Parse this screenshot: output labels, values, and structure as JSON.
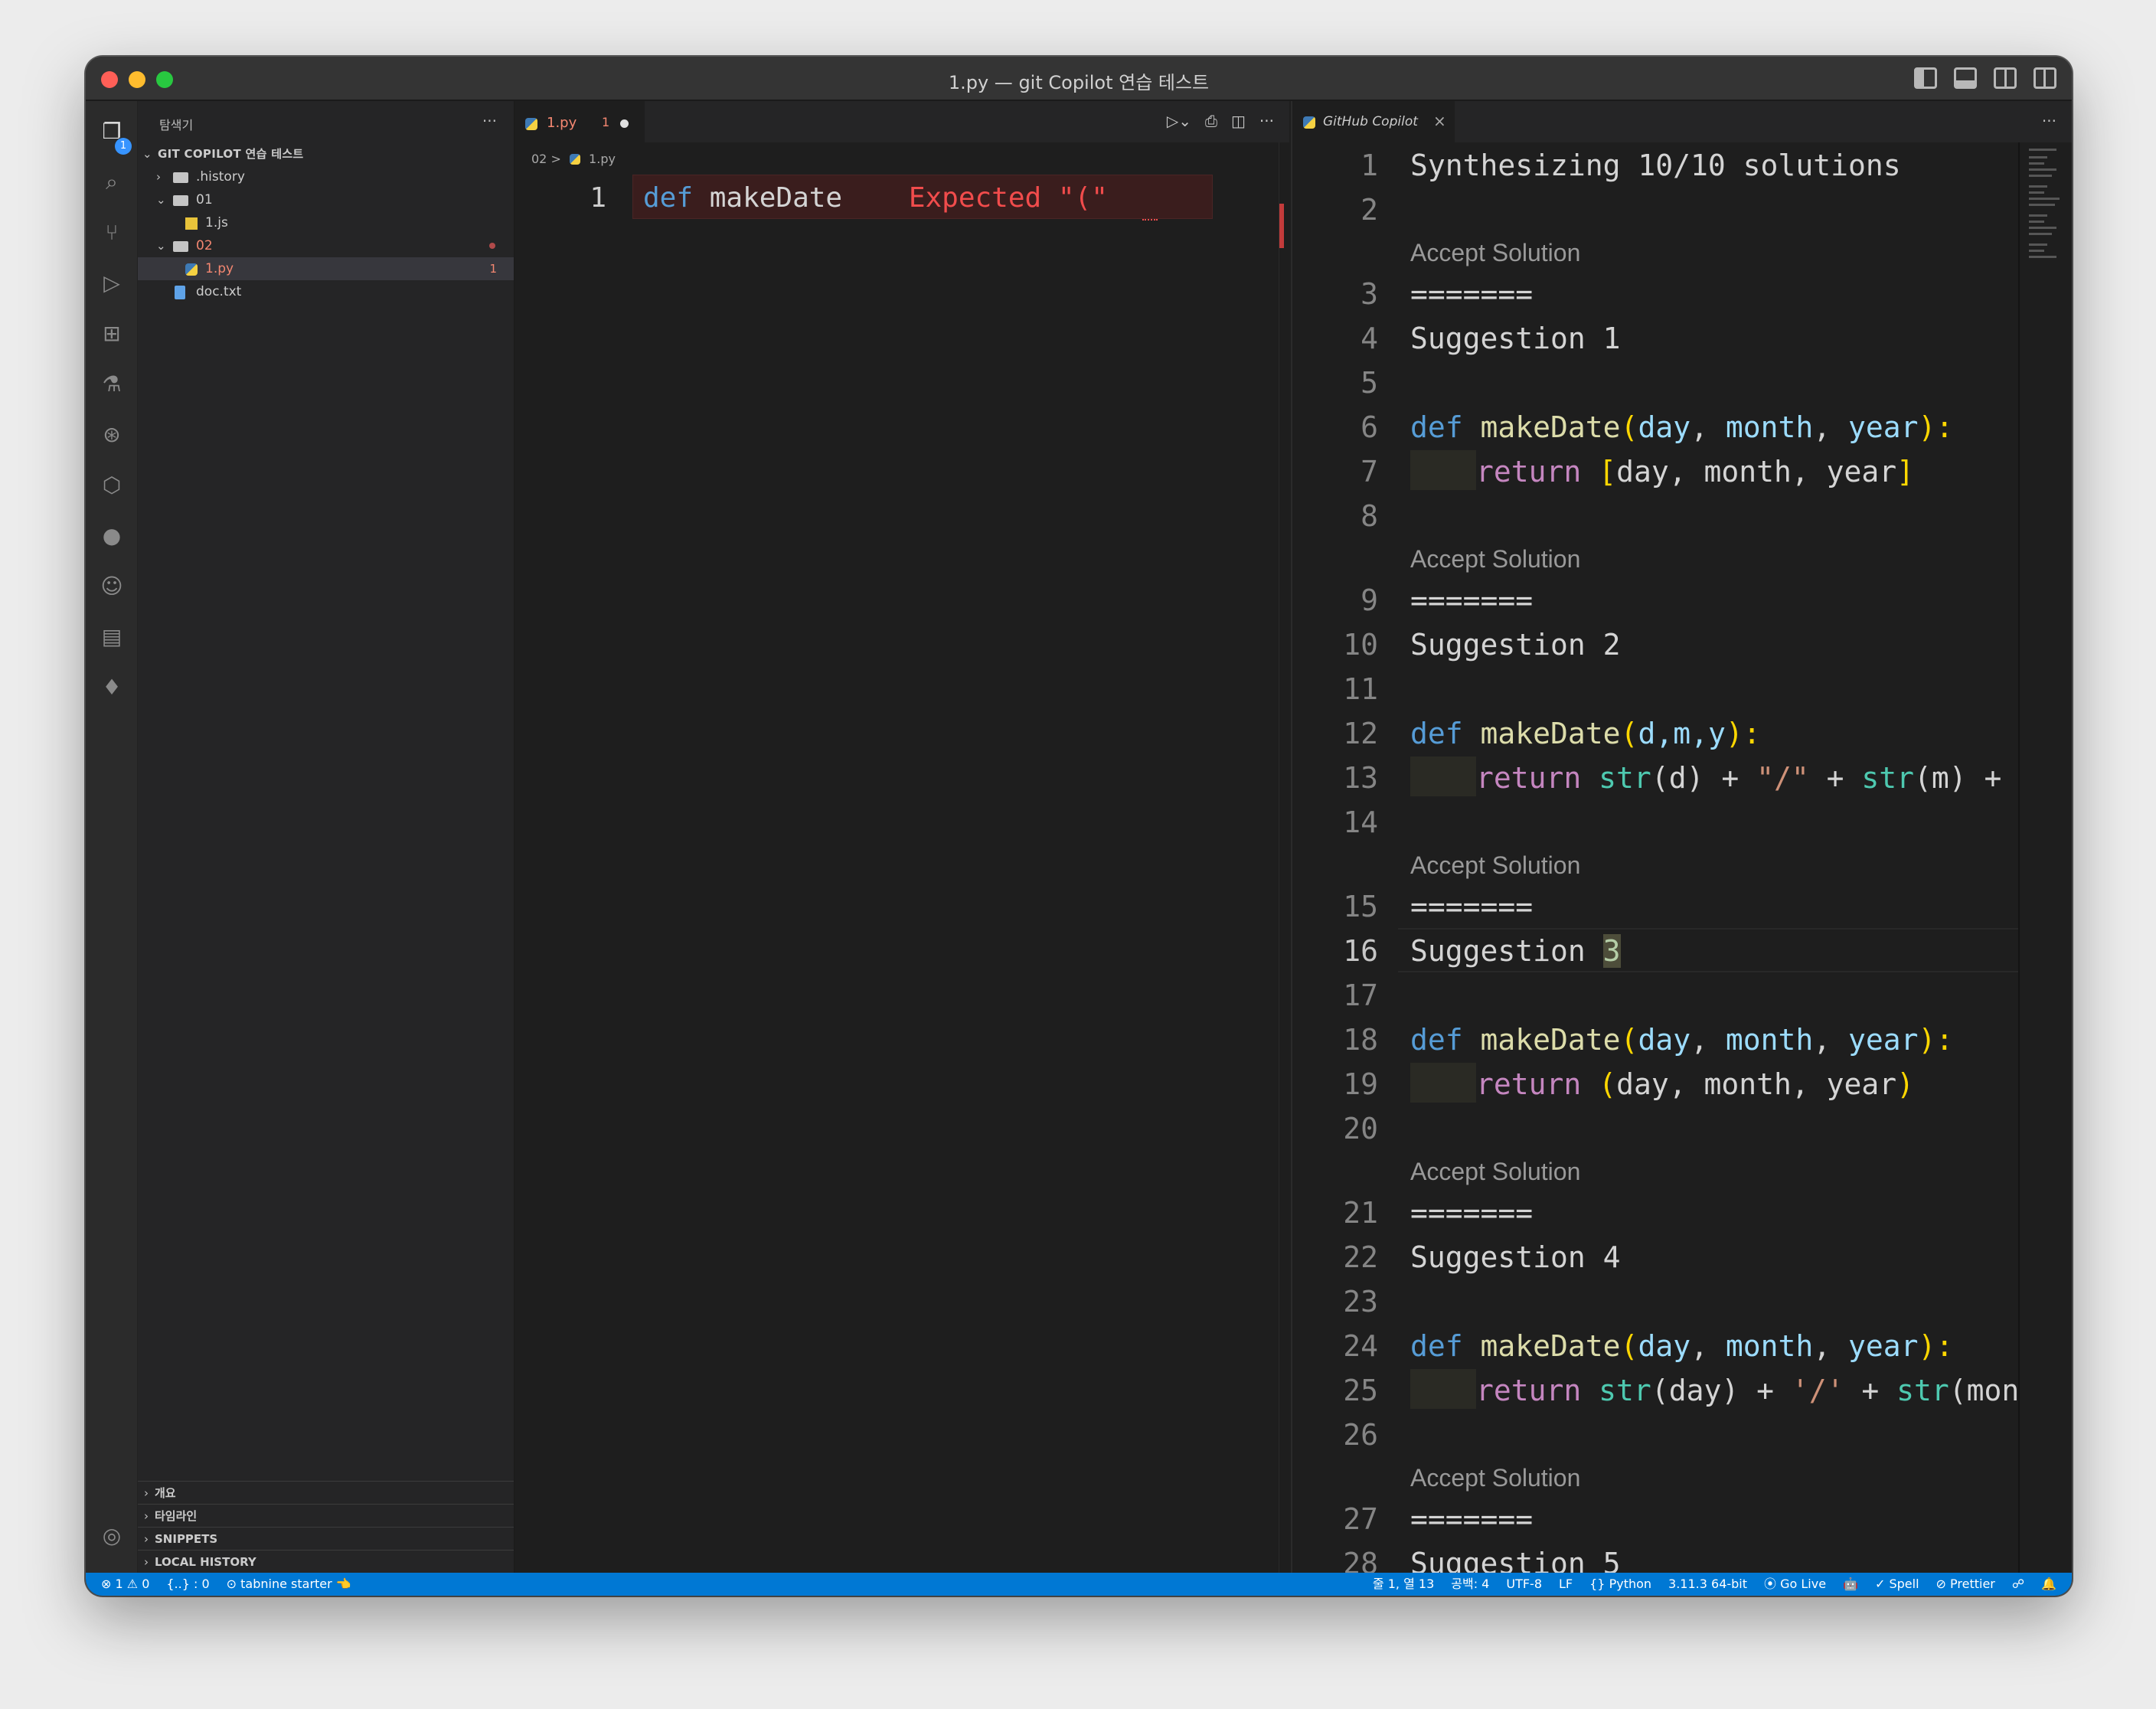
{
  "window": {
    "title": "1.py — git Copilot 연습 테스트"
  },
  "activity_bar": {
    "explorer_badge": "1"
  },
  "sidebar": {
    "header": "탐색기",
    "more": "···",
    "root": "GIT COPILOT 연습 테스트",
    "items": [
      {
        "label": ".history"
      },
      {
        "label": "01"
      },
      {
        "label": "1.js"
      },
      {
        "label": "02"
      },
      {
        "label": "1.py",
        "problems": "1"
      },
      {
        "label": "doc.txt"
      }
    ],
    "sections": [
      {
        "label": "개요"
      },
      {
        "label": "타임라인"
      },
      {
        "label": "SNIPPETS"
      },
      {
        "label": "LOCAL HISTORY"
      }
    ]
  },
  "editor_left": {
    "tab": {
      "label": "1.py",
      "problems": "1"
    },
    "breadcrumb": {
      "folder": "02",
      "sep": ">",
      "file": "1.py"
    },
    "line_number": "1",
    "code": {
      "keyword": "def",
      "name": "makeDate",
      "error": "Expected \"(\""
    }
  },
  "editor_right": {
    "tab": {
      "label": "GitHub Copilot",
      "close": "×"
    },
    "more": "···",
    "accept_label": "Accept Solution",
    "lines": {
      "l1": "Synthesizing 10/10 solutions",
      "l3": "=======",
      "l4": "Suggestion 1",
      "l6a": "def",
      "l6b": "makeDate",
      "l6c": "(",
      "l6d": "day",
      "l6e": ", ",
      "l6f": "month",
      "l6g": ", ",
      "l6h": "year",
      "l6i": "):",
      "l7a": "return",
      "l7b": "[",
      "l7c": "day, month, year",
      "l7d": "]",
      "l9": "=======",
      "l10": "Suggestion 2",
      "l12a": "def",
      "l12b": "makeDate",
      "l12c": "(",
      "l12d": "d,m,y",
      "l12e": "):",
      "l13a": "return",
      "l13b": "str",
      "l13c": "(d) + ",
      "l13d": "\"/\"",
      "l13e": " + ",
      "l13f": "str",
      "l13g": "(m) + ",
      "l13h": "\",",
      "l15": "=======",
      "l16a": "Suggestion ",
      "l16b": "3",
      "l18a": "def",
      "l18b": "makeDate",
      "l18c": "(",
      "l18d": "day",
      "l18e": ", ",
      "l18f": "month",
      "l18g": ", ",
      "l18h": "year",
      "l18i": "):",
      "l19a": "return",
      "l19b": "(",
      "l19c": "day, month, year",
      "l19d": ")",
      "l21": "=======",
      "l22": "Suggestion 4",
      "l24a": "def",
      "l24b": "makeDate",
      "l24c": "(",
      "l24d": "day",
      "l24e": ", ",
      "l24f": "month",
      "l24g": ", ",
      "l24h": "year",
      "l24i": "):",
      "l25a": "return",
      "l25b": "str",
      "l25c": "(day) + ",
      "l25d": "'/'",
      "l25e": " + ",
      "l25f": "str",
      "l25g": "(montl",
      "l27": "=======",
      "l28": "Suggestion 5"
    },
    "line_numbers": [
      "1",
      "2",
      "3",
      "4",
      "5",
      "6",
      "7",
      "8",
      "9",
      "10",
      "11",
      "12",
      "13",
      "14",
      "15",
      "16",
      "17",
      "18",
      "19",
      "20",
      "21",
      "22",
      "23",
      "24",
      "25",
      "26",
      "27",
      "28"
    ]
  },
  "statusbar": {
    "problems": "⊗ 1 ⚠ 0",
    "braces": "{..} : 0",
    "tabnine": "⊙ tabnine starter 👈",
    "position": "줄 1, 열 13",
    "spaces": "공백: 4",
    "encoding": "UTF-8",
    "eol": "LF",
    "language": "{} Python",
    "interpreter": "3.11.3 64-bit",
    "golive": "⦿ Go Live",
    "copilot": "🤖",
    "spell": "✓ Spell",
    "prettier": "⊘ Prettier",
    "feedback": "☍",
    "bell": "🔔"
  }
}
